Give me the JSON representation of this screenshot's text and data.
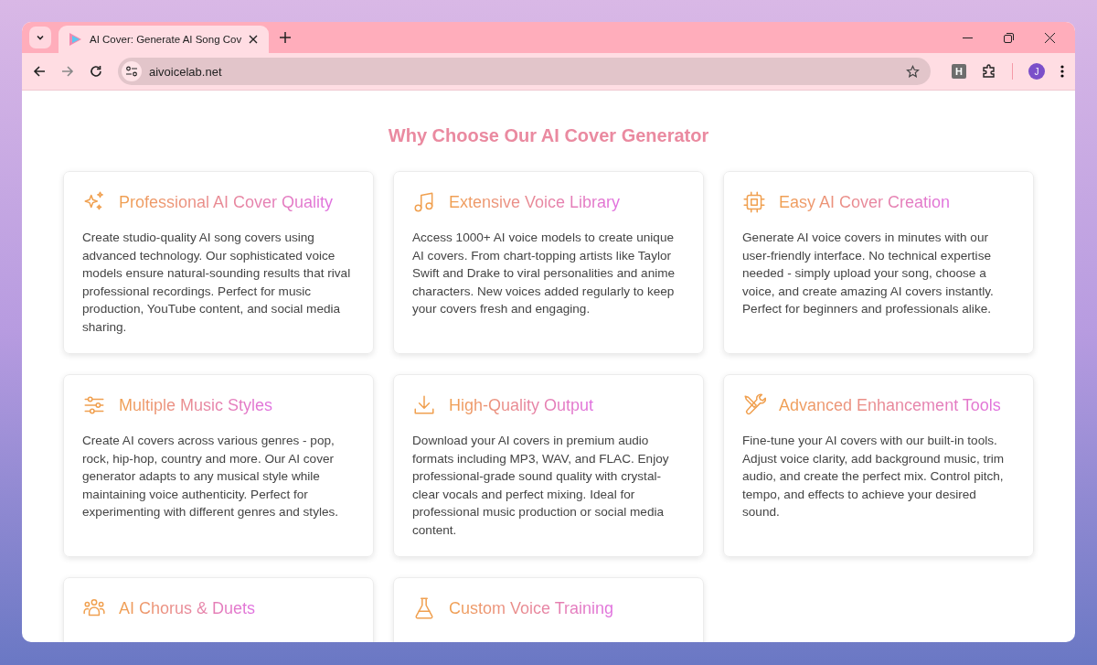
{
  "browser": {
    "tab": {
      "title": "AI Cover: Generate AI Song Cov",
      "selected": true
    },
    "address": "aivoicelab.net",
    "profile_initial": "J",
    "extension_letter": "H"
  },
  "section": {
    "heading": "Why Choose Our AI Cover Generator",
    "features": [
      {
        "title": "Professional AI Cover Quality",
        "description": "Create studio-quality AI song covers using advanced technology. Our sophisticated voice models ensure natural-sounding results that rival professional recordings. Perfect for music production, YouTube content, and social media sharing."
      },
      {
        "title": "Extensive Voice Library",
        "description": "Access 1000+ AI voice models to create unique AI covers. From chart-topping artists like Taylor Swift and Drake to viral personalities and anime characters. New voices added regularly to keep your covers fresh and engaging."
      },
      {
        "title": "Easy AI Cover Creation",
        "description": "Generate AI voice covers in minutes with our user-friendly interface. No technical expertise needed - simply upload your song, choose a voice, and create amazing AI covers instantly. Perfect for beginners and professionals alike."
      },
      {
        "title": "Multiple Music Styles",
        "description": "Create AI covers across various genres - pop, rock, hip-hop, country and more. Our AI cover generator adapts to any musical style while maintaining voice authenticity. Perfect for experimenting with different genres and styles."
      },
      {
        "title": "High-Quality Output",
        "description": "Download your AI covers in premium audio formats including MP3, WAV, and FLAC. Enjoy professional-grade sound quality with crystal-clear vocals and perfect mixing. Ideal for professional music production or social media content."
      },
      {
        "title": "Advanced Enhancement Tools",
        "description": "Fine-tune your AI covers with our built-in tools. Adjust voice clarity, add background music, trim audio, and create the perfect mix. Control pitch, tempo, and effects to achieve your desired sound."
      },
      {
        "title": "AI Chorus & Duets"
      },
      {
        "title": "Custom Voice Training"
      }
    ]
  }
}
